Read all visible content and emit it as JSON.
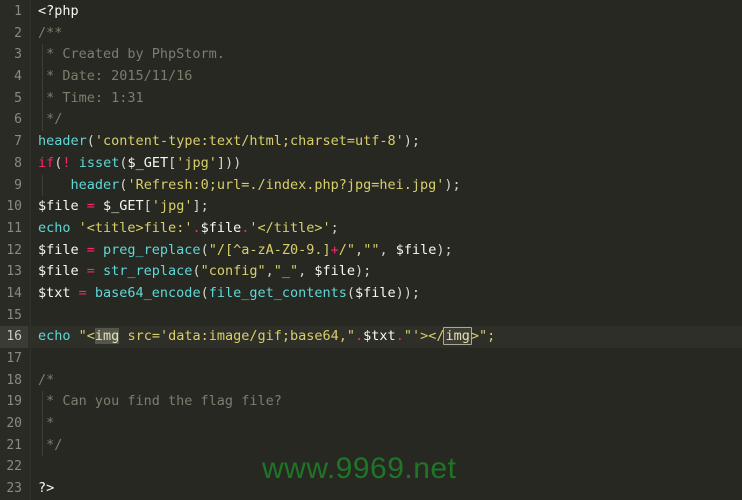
{
  "editor": {
    "language": "php",
    "background": "#272822",
    "gutter_background": "#2b2b26",
    "current_line": 16,
    "current_line_background": "#2e2f28"
  },
  "colors": {
    "keyword": "#f92672",
    "function": "#5fd7d7",
    "string": "#d8cf6a",
    "variable": "#f8f8f2",
    "punctuation": "#d4d4c8",
    "comment": "#7a7f6d",
    "line_number": "#8a8a80",
    "watermark": "#1f7a28"
  },
  "lines": [
    {
      "n": "1",
      "text": "<?php"
    },
    {
      "n": "2",
      "text": "/**"
    },
    {
      "n": "3",
      "text": " * Created by PhpStorm."
    },
    {
      "n": "4",
      "text": " * Date: 2015/11/16"
    },
    {
      "n": "5",
      "text": " * Time: 1:31"
    },
    {
      "n": "6",
      "text": " */"
    },
    {
      "n": "7",
      "text": "header('content-type:text/html;charset=utf-8');"
    },
    {
      "n": "8",
      "text": "if(! isset($_GET['jpg']))"
    },
    {
      "n": "9",
      "text": "    header('Refresh:0;url=./index.php?jpg=hei.jpg');"
    },
    {
      "n": "10",
      "text": "$file = $_GET['jpg'];"
    },
    {
      "n": "11",
      "text": "echo '<title>file:'.$file.'</title>';"
    },
    {
      "n": "12",
      "text": "$file = preg_replace(\"/[^a-zA-Z0-9.]+/\",\"\", $file);"
    },
    {
      "n": "13",
      "text": "$file = str_replace(\"config\",\"_\", $file);"
    },
    {
      "n": "14",
      "text": "$txt = base64_encode(file_get_contents($file));"
    },
    {
      "n": "15",
      "text": ""
    },
    {
      "n": "16",
      "text": "echo \"<img src='data:image/gif;base64,\".$txt.\"'></img>\";"
    },
    {
      "n": "17",
      "text": ""
    },
    {
      "n": "18",
      "text": "/*"
    },
    {
      "n": "19",
      "text": " * Can you find the flag file?"
    },
    {
      "n": "20",
      "text": " *"
    },
    {
      "n": "21",
      "text": " */"
    },
    {
      "n": "22",
      "text": ""
    },
    {
      "n": "23",
      "text": "?>"
    }
  ],
  "line_numbers": {
    "l1": "1",
    "l2": "2",
    "l3": "3",
    "l4": "4",
    "l5": "5",
    "l6": "6",
    "l7": "7",
    "l8": "8",
    "l9": "9",
    "l10": "10",
    "l11": "11",
    "l12": "12",
    "l13": "13",
    "l14": "14",
    "l15": "15",
    "l16": "16",
    "l17": "17",
    "l18": "18",
    "l19": "19",
    "l20": "20",
    "l21": "21",
    "l22": "22",
    "l23": "23"
  },
  "tokens": {
    "l1_php_open": "<?php",
    "l2_comment": "/**",
    "l3_comment": " * Created by PhpStorm.",
    "l4_comment": " * Date: 2015/11/16",
    "l5_comment": " * Time: 1:31",
    "l6_comment": " */",
    "l7_fn": "header",
    "l7_open": "(",
    "l7_str": "'content-type:text/html;charset=utf-8'",
    "l7_close": ");",
    "l8_if": "if",
    "l8_open": "(",
    "l8_not": "!",
    "l8_space": " ",
    "l8_fn": "isset",
    "l8_open2": "(",
    "l8_var": "$_GET",
    "l8_lb": "[",
    "l8_str": "'jpg'",
    "l8_rb": "]",
    "l8_close": "))",
    "l9_indent": "    ",
    "l9_fn": "header",
    "l9_open": "(",
    "l9_str": "'Refresh:0;url=./index.php?jpg=hei.jpg'",
    "l9_close": ");",
    "l10_var": "$file",
    "l10_eq": " = ",
    "l10_var2": "$_GET",
    "l10_lb": "[",
    "l10_str": "'jpg'",
    "l10_rb": "]",
    "l10_semi": ";",
    "l11_echo": "echo",
    "l11_sp": " ",
    "l11_str1": "'<title>file:'",
    "l11_dot1": ".",
    "l11_var": "$file",
    "l11_dot2": ".",
    "l11_str2": "'</title>'",
    "l11_semi": ";",
    "l12_var": "$file",
    "l12_eq": " = ",
    "l12_fn": "preg_replace",
    "l12_open": "(",
    "l12_str_a": "\"/[^a-zA-Z0-9.]",
    "l12_plus": "+",
    "l12_str_b": "/\"",
    "l12_comma": ",",
    "l12_str_c": "\"\"",
    "l12_comma2": ", ",
    "l12_var2": "$file",
    "l12_close": ");",
    "l13_var": "$file",
    "l13_eq": " = ",
    "l13_fn": "str_replace",
    "l13_open": "(",
    "l13_str1": "\"config\"",
    "l13_comma": ",",
    "l13_str2": "\"_\"",
    "l13_comma2": ", ",
    "l13_var2": "$file",
    "l13_close": ");",
    "l14_var": "$txt",
    "l14_eq": " = ",
    "l14_fn": "base64_encode",
    "l14_open": "(",
    "l14_fn2": "file_get_contents",
    "l14_open2": "(",
    "l14_var2": "$file",
    "l14_close": "));",
    "l16_echo": "echo",
    "l16_sp": " ",
    "l16_q1": "\"<",
    "l16_tag_open": "img",
    "l16_attr": " src='data:image/gif;base64,",
    "l16_q2": "\"",
    "l16_dot1": ".",
    "l16_var": "$txt",
    "l16_dot2": ".",
    "l16_q3": "\"'></",
    "l16_tag_close": "img",
    "l16_q4": ">\";",
    "l18_comment": "/*",
    "l19_comment": " * Can you find the flag file?",
    "l20_comment": " *",
    "l21_comment": " */",
    "l23_php_close": "?>"
  },
  "watermark": {
    "text": "www.9969.net"
  }
}
